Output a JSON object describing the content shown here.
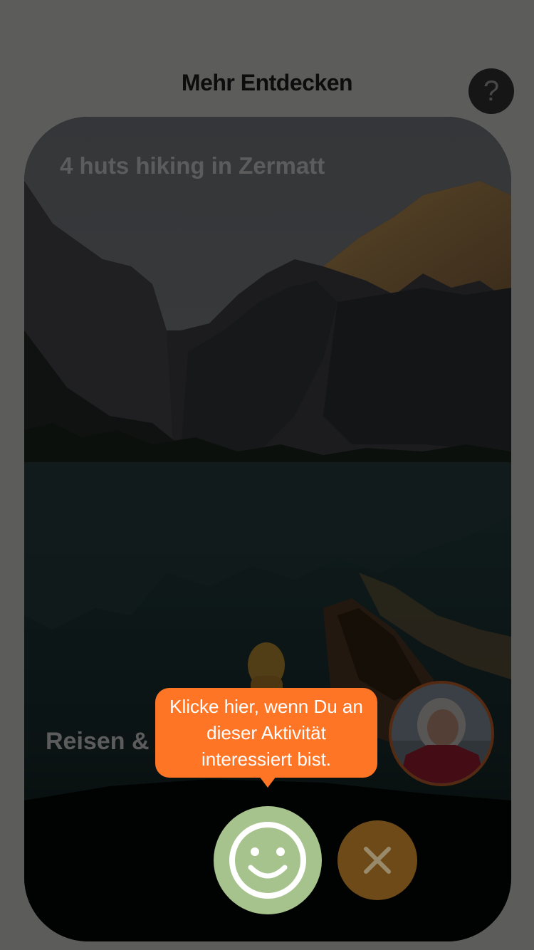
{
  "header": {
    "title": "Mehr Entdecken",
    "help_label": "?"
  },
  "card": {
    "title": "4 huts hiking in Zermatt",
    "category": "Reisen & "
  },
  "tooltip": {
    "text": "Klicke hier, wenn Du an dieser Aktivität interessiert bist."
  },
  "actions": {
    "like_icon": "smiley-icon",
    "dislike_icon": "close-icon"
  },
  "colors": {
    "accent_orange": "#ff7526",
    "like_green": "#a7c38d",
    "dislike_brown": "#6e4a18",
    "overlay": "rgba(0,0,0,0.62)"
  }
}
